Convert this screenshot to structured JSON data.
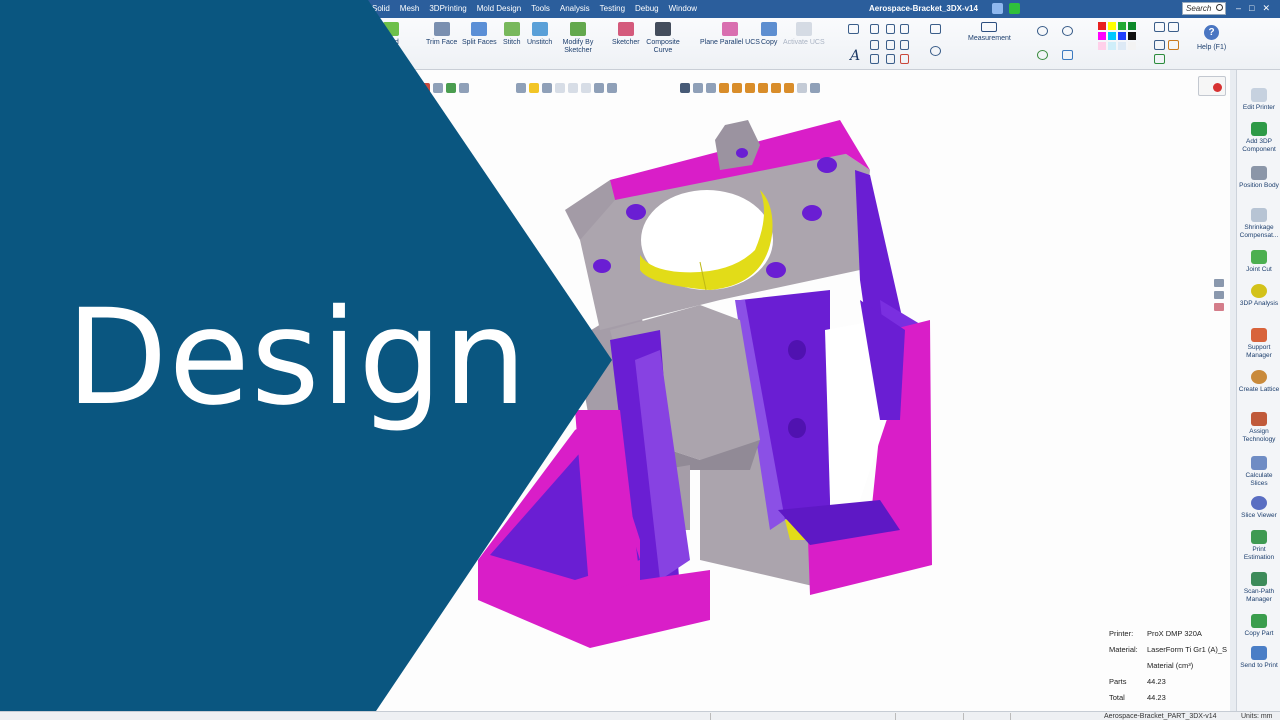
{
  "menubar": {
    "menus": [
      "Solid",
      "Mesh",
      "3DPrinting",
      "Mold Design",
      "Tools",
      "Analysis",
      "Testing",
      "Debug",
      "Window"
    ],
    "window_title": "Aerospace-Bracket_3DX-v14",
    "search_placeholder": "Search"
  },
  "ribbon": {
    "buttons": [
      "nded",
      "Trim Face",
      "Split Faces",
      "Stitch",
      "Unstitch",
      "Modify By Sketcher",
      "Sketcher",
      "Composite Curve",
      "Plane Parallel UCS",
      "Copy",
      "Activate UCS",
      "Measurement"
    ],
    "help_label": "Help (F1)",
    "help_glyph": "?"
  },
  "right_panel": {
    "items": [
      "Edit Printer",
      "Add 3DP Component",
      "Position Body",
      "Shrinkage Compensat...",
      "Joint Cut",
      "3DP Analysis",
      "Support Manager",
      "Create Lattice",
      "Assign Technology",
      "Calculate Slices",
      "Slice Viewer",
      "Print Estimation",
      "Scan-Path Manager",
      "Copy Part",
      "Send to Print"
    ]
  },
  "info": {
    "printer_label": "Printer:",
    "printer_value": "ProX DMP 320A",
    "material_label": "Material:",
    "material_value": "LaserForm Ti Gr1 (A)_S",
    "material_unit": "Material (cm³)",
    "parts_label": "Parts",
    "parts_value": "44.23",
    "total_label": "Total",
    "total_value": "44.23"
  },
  "statusbar": {
    "file": "Aerospace-Bracket_PART_3DX-v14",
    "units": "Units: mm"
  },
  "overlay": {
    "headline": "Design",
    "color": "#0a5680"
  },
  "colors": {
    "magenta": "#d91ec8",
    "purple": "#6a1ed3",
    "grey": "#aba4ad",
    "yellow": "#e2dc18"
  }
}
